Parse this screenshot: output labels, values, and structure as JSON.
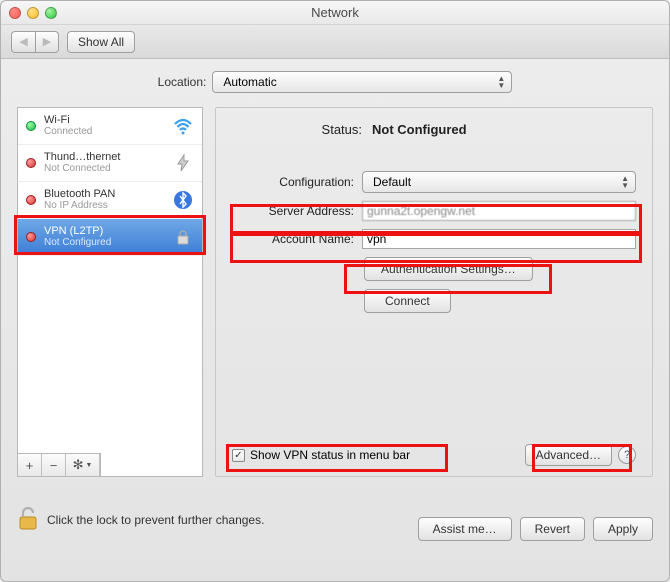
{
  "window": {
    "title": "Network"
  },
  "toolbar": {
    "show_all": "Show All"
  },
  "location": {
    "label": "Location:",
    "value": "Automatic"
  },
  "sidebar": {
    "items": [
      {
        "name": "Wi-Fi",
        "sub": "Connected",
        "status": "green",
        "icon": "wifi"
      },
      {
        "name": "Thund…thernet",
        "sub": "Not Connected",
        "status": "red",
        "icon": "thunderbolt"
      },
      {
        "name": "Bluetooth PAN",
        "sub": "No IP Address",
        "status": "red",
        "icon": "bluetooth"
      },
      {
        "name": "VPN (L2TP)",
        "sub": "Not Configured",
        "status": "red",
        "icon": "vpn",
        "selected": true
      }
    ],
    "controls": {
      "add": "+",
      "remove": "−",
      "gear": "✻"
    }
  },
  "status": {
    "label": "Status:",
    "value": "Not Configured"
  },
  "form": {
    "configuration_label": "Configuration:",
    "configuration_value": "Default",
    "server_label": "Server Address:",
    "server_value": "gunna2t.opengw.net",
    "account_label": "Account Name:",
    "account_value": "vpn",
    "auth_button": "Authentication Settings…",
    "connect_button": "Connect"
  },
  "footer": {
    "checkbox_label": "Show VPN status in menu bar",
    "checkbox_checked": true,
    "advanced_button": "Advanced…"
  },
  "lock": {
    "text": "Click the lock to prevent further changes."
  },
  "bottom": {
    "assist": "Assist me…",
    "revert": "Revert",
    "apply": "Apply"
  }
}
